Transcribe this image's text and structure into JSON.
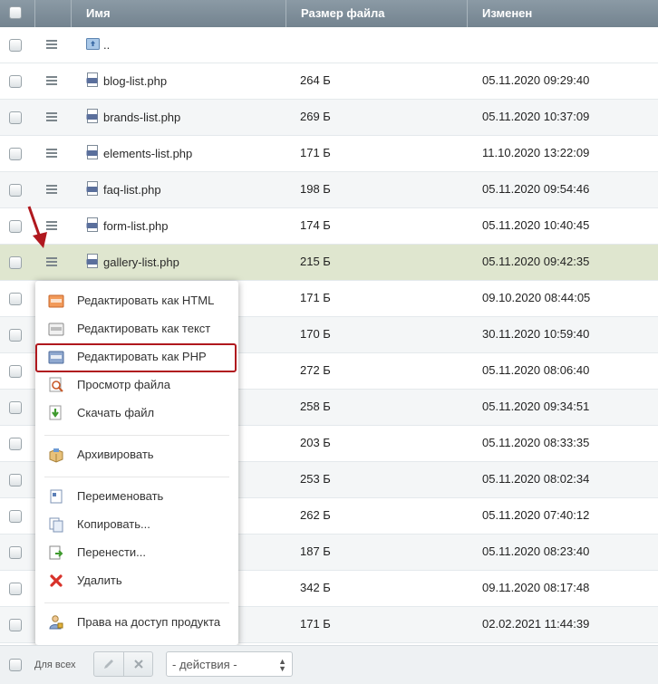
{
  "columns": {
    "name": "Имя",
    "size": "Размер файла",
    "modified": "Изменен"
  },
  "up_label": "..",
  "rows": [
    {
      "name": "blog-list.php",
      "size": "264 Б",
      "date": "05.11.2020 09:29:40"
    },
    {
      "name": "brands-list.php",
      "size": "269 Б",
      "date": "05.11.2020 10:37:09"
    },
    {
      "name": "elements-list.php",
      "size": "171 Б",
      "date": "11.10.2020 13:22:09"
    },
    {
      "name": "faq-list.php",
      "size": "198 Б",
      "date": "05.11.2020 09:54:46"
    },
    {
      "name": "form-list.php",
      "size": "174 Б",
      "date": "05.11.2020 10:40:45"
    },
    {
      "name": "gallery-list.php",
      "size": "215 Б",
      "date": "05.11.2020 09:42:35"
    },
    {
      "name": "",
      "size": "171 Б",
      "date": "09.10.2020 08:44:05"
    },
    {
      "name": "",
      "size": "170 Б",
      "date": "30.11.2020 10:59:40"
    },
    {
      "name": "",
      "size": "272 Б",
      "date": "05.11.2020 08:06:40"
    },
    {
      "name": "",
      "size": "258 Б",
      "date": "05.11.2020 09:34:51"
    },
    {
      "name": "",
      "size": "203 Б",
      "date": "05.11.2020 08:33:35"
    },
    {
      "name": "",
      "size": "253 Б",
      "date": "05.11.2020 08:02:34"
    },
    {
      "name": "",
      "size": "262 Б",
      "date": "05.11.2020 07:40:12"
    },
    {
      "name": "",
      "size": "187 Б",
      "date": "05.11.2020 08:23:40"
    },
    {
      "name": "",
      "size": "342 Б",
      "date": "09.11.2020 08:17:48"
    },
    {
      "name": "",
      "size": "171 Б",
      "date": "02.02.2021 11:44:39"
    }
  ],
  "menu": {
    "edit_html": "Редактировать как HTML",
    "edit_text": "Редактировать как текст",
    "edit_php": "Редактировать как PHP",
    "view": "Просмотр файла",
    "download": "Скачать файл",
    "archive": "Архивировать",
    "rename": "Переименовать",
    "copy": "Копировать...",
    "move": "Перенести...",
    "delete": "Удалить",
    "access": "Права на доступ продукта"
  },
  "footer": {
    "for_all": "Для всех",
    "actions_select": "- действия -"
  },
  "colors": {
    "header": "#7f8f9b",
    "selected_row": "#dfe6cf",
    "highlight": "#b0181e",
    "arrow": "#b0181e"
  }
}
